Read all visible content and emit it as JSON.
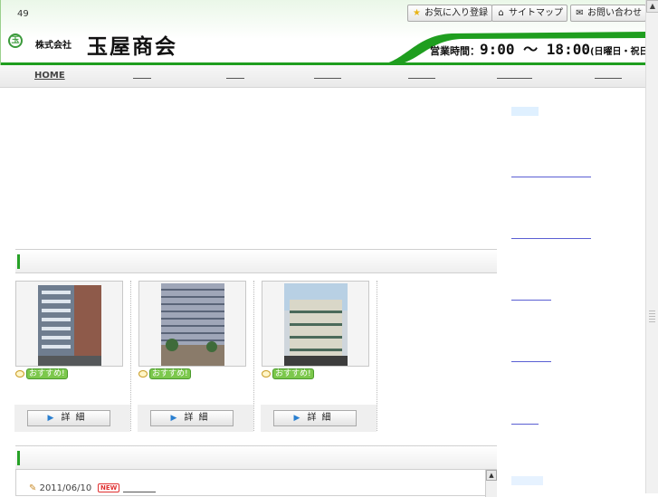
{
  "header": {
    "counter": "49",
    "buttons": {
      "favorite": "お気に入り登録",
      "sitemap": "サイトマップ",
      "contact": "お問い合わせ"
    },
    "company_prefix": "株式会社",
    "company_name": "玉屋商会",
    "hours_label": "営業時間：",
    "hours_time": "9:00 〜 18:00",
    "hours_note": "(日曜日・祝日定休"
  },
  "nav": {
    "home": "HOME"
  },
  "listings": [
    {
      "badge": "おすすめ!",
      "detail_label": "詳細"
    },
    {
      "badge": "おすすめ!",
      "detail_label": "詳細"
    },
    {
      "badge": "おすすめ!",
      "detail_label": "詳細"
    }
  ],
  "news": {
    "date": "2011/06/10",
    "new_badge": "NEW"
  },
  "colors": {
    "accent_green": "#1f9e1f",
    "link_blue": "#5a5fd3"
  }
}
